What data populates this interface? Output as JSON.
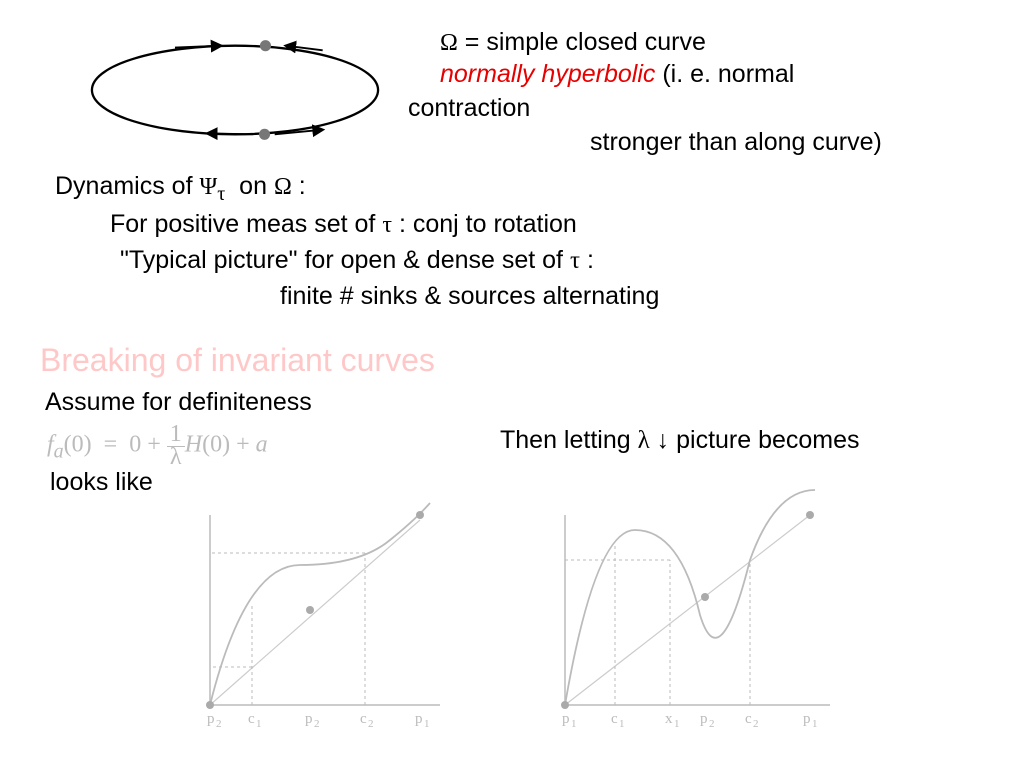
{
  "top": {
    "line1": "= simple closed curve",
    "line2a": "normally hyperbolic",
    "line2b": "  (i. e. normal",
    "line3": "contraction",
    "line4": "stronger than along curve)"
  },
  "symbols": {
    "omega": "Ω",
    "psi": "Ψ",
    "tau": "τ",
    "lambda": "λ",
    "downarrow": "↓"
  },
  "dynamics": {
    "line1a": "Dynamics of",
    "line1b": "on",
    "line1c": "  :",
    "line2a": "For positive meas set of",
    "line2b": "   :   conj to rotation",
    "line3a": "\"Typical picture\" for open & dense set of",
    "line3b": "τ",
    "line3c": "   :",
    "line4": "finite # sinks & sources alternating"
  },
  "section_title": "Breaking of invariant curves",
  "assume": "Assume for definiteness",
  "formula": "fₐ(0)  =  0 + (1/λ) H(0) + a",
  "looks_like": "looks like",
  "then": {
    "prefix": "Then letting  ",
    "suffix": "   picture becomes"
  },
  "plots": {
    "left": {
      "xlabels": [
        "p₂",
        "c₁",
        "p₂",
        "c₂",
        "p₁"
      ]
    },
    "right": {
      "xlabels": [
        "p₁",
        "c₁",
        "x₁",
        "p₂",
        "c₂",
        "p₁"
      ]
    }
  }
}
